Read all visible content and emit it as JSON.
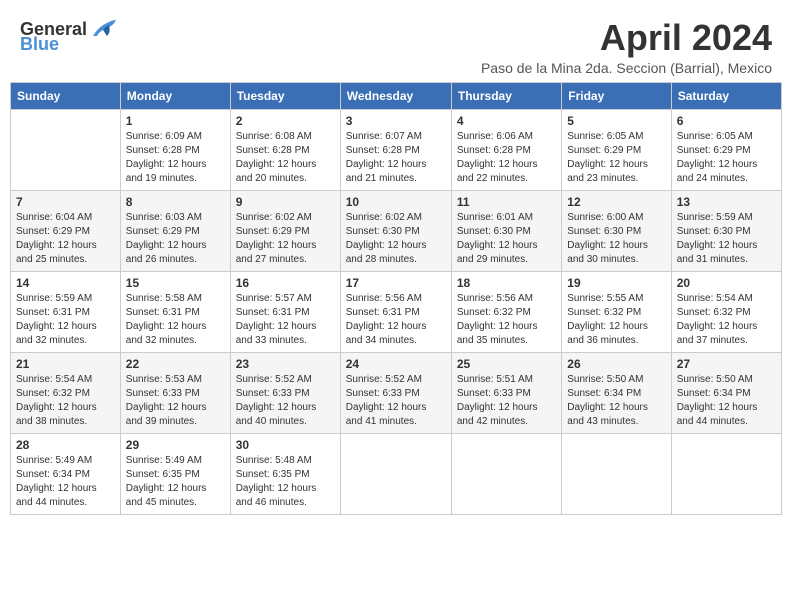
{
  "header": {
    "logo_general": "General",
    "logo_blue": "Blue",
    "title": "April 2024",
    "location": "Paso de la Mina 2da. Seccion (Barrial), Mexico"
  },
  "calendar": {
    "days_of_week": [
      "Sunday",
      "Monday",
      "Tuesday",
      "Wednesday",
      "Thursday",
      "Friday",
      "Saturday"
    ],
    "weeks": [
      [
        {
          "day": "",
          "info": ""
        },
        {
          "day": "1",
          "info": "Sunrise: 6:09 AM\nSunset: 6:28 PM\nDaylight: 12 hours\nand 19 minutes."
        },
        {
          "day": "2",
          "info": "Sunrise: 6:08 AM\nSunset: 6:28 PM\nDaylight: 12 hours\nand 20 minutes."
        },
        {
          "day": "3",
          "info": "Sunrise: 6:07 AM\nSunset: 6:28 PM\nDaylight: 12 hours\nand 21 minutes."
        },
        {
          "day": "4",
          "info": "Sunrise: 6:06 AM\nSunset: 6:28 PM\nDaylight: 12 hours\nand 22 minutes."
        },
        {
          "day": "5",
          "info": "Sunrise: 6:05 AM\nSunset: 6:29 PM\nDaylight: 12 hours\nand 23 minutes."
        },
        {
          "day": "6",
          "info": "Sunrise: 6:05 AM\nSunset: 6:29 PM\nDaylight: 12 hours\nand 24 minutes."
        }
      ],
      [
        {
          "day": "7",
          "info": "Sunrise: 6:04 AM\nSunset: 6:29 PM\nDaylight: 12 hours\nand 25 minutes."
        },
        {
          "day": "8",
          "info": "Sunrise: 6:03 AM\nSunset: 6:29 PM\nDaylight: 12 hours\nand 26 minutes."
        },
        {
          "day": "9",
          "info": "Sunrise: 6:02 AM\nSunset: 6:29 PM\nDaylight: 12 hours\nand 27 minutes."
        },
        {
          "day": "10",
          "info": "Sunrise: 6:02 AM\nSunset: 6:30 PM\nDaylight: 12 hours\nand 28 minutes."
        },
        {
          "day": "11",
          "info": "Sunrise: 6:01 AM\nSunset: 6:30 PM\nDaylight: 12 hours\nand 29 minutes."
        },
        {
          "day": "12",
          "info": "Sunrise: 6:00 AM\nSunset: 6:30 PM\nDaylight: 12 hours\nand 30 minutes."
        },
        {
          "day": "13",
          "info": "Sunrise: 5:59 AM\nSunset: 6:30 PM\nDaylight: 12 hours\nand 31 minutes."
        }
      ],
      [
        {
          "day": "14",
          "info": "Sunrise: 5:59 AM\nSunset: 6:31 PM\nDaylight: 12 hours\nand 32 minutes."
        },
        {
          "day": "15",
          "info": "Sunrise: 5:58 AM\nSunset: 6:31 PM\nDaylight: 12 hours\nand 32 minutes."
        },
        {
          "day": "16",
          "info": "Sunrise: 5:57 AM\nSunset: 6:31 PM\nDaylight: 12 hours\nand 33 minutes."
        },
        {
          "day": "17",
          "info": "Sunrise: 5:56 AM\nSunset: 6:31 PM\nDaylight: 12 hours\nand 34 minutes."
        },
        {
          "day": "18",
          "info": "Sunrise: 5:56 AM\nSunset: 6:32 PM\nDaylight: 12 hours\nand 35 minutes."
        },
        {
          "day": "19",
          "info": "Sunrise: 5:55 AM\nSunset: 6:32 PM\nDaylight: 12 hours\nand 36 minutes."
        },
        {
          "day": "20",
          "info": "Sunrise: 5:54 AM\nSunset: 6:32 PM\nDaylight: 12 hours\nand 37 minutes."
        }
      ],
      [
        {
          "day": "21",
          "info": "Sunrise: 5:54 AM\nSunset: 6:32 PM\nDaylight: 12 hours\nand 38 minutes."
        },
        {
          "day": "22",
          "info": "Sunrise: 5:53 AM\nSunset: 6:33 PM\nDaylight: 12 hours\nand 39 minutes."
        },
        {
          "day": "23",
          "info": "Sunrise: 5:52 AM\nSunset: 6:33 PM\nDaylight: 12 hours\nand 40 minutes."
        },
        {
          "day": "24",
          "info": "Sunrise: 5:52 AM\nSunset: 6:33 PM\nDaylight: 12 hours\nand 41 minutes."
        },
        {
          "day": "25",
          "info": "Sunrise: 5:51 AM\nSunset: 6:33 PM\nDaylight: 12 hours\nand 42 minutes."
        },
        {
          "day": "26",
          "info": "Sunrise: 5:50 AM\nSunset: 6:34 PM\nDaylight: 12 hours\nand 43 minutes."
        },
        {
          "day": "27",
          "info": "Sunrise: 5:50 AM\nSunset: 6:34 PM\nDaylight: 12 hours\nand 44 minutes."
        }
      ],
      [
        {
          "day": "28",
          "info": "Sunrise: 5:49 AM\nSunset: 6:34 PM\nDaylight: 12 hours\nand 44 minutes."
        },
        {
          "day": "29",
          "info": "Sunrise: 5:49 AM\nSunset: 6:35 PM\nDaylight: 12 hours\nand 45 minutes."
        },
        {
          "day": "30",
          "info": "Sunrise: 5:48 AM\nSunset: 6:35 PM\nDaylight: 12 hours\nand 46 minutes."
        },
        {
          "day": "",
          "info": ""
        },
        {
          "day": "",
          "info": ""
        },
        {
          "day": "",
          "info": ""
        },
        {
          "day": "",
          "info": ""
        }
      ]
    ]
  }
}
